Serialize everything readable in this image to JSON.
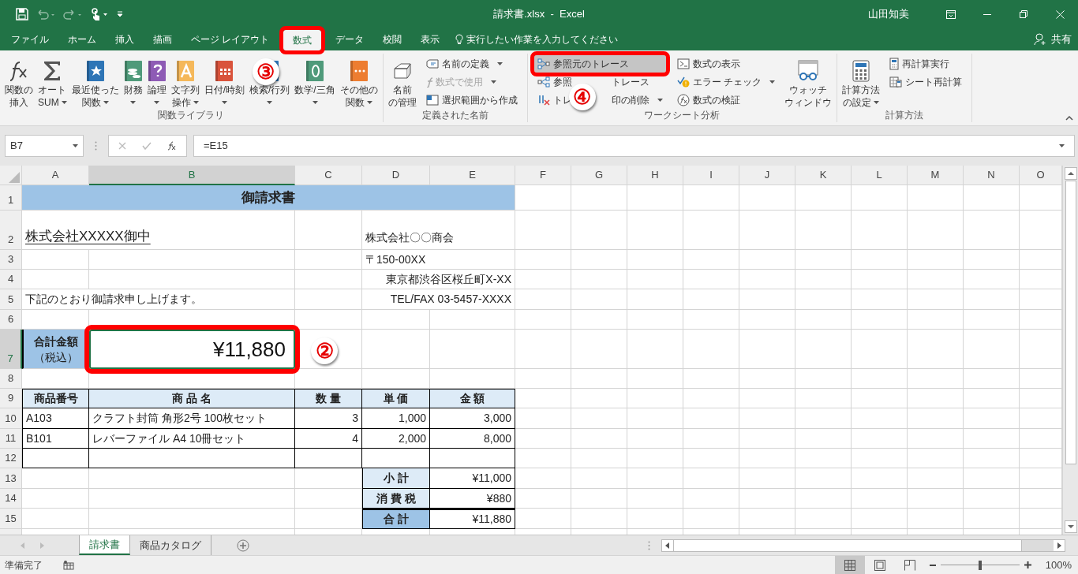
{
  "title_bar": {
    "title": "請求書.xlsx  -  Excel",
    "user": "山田知美"
  },
  "menu_tabs": [
    {
      "label": "ファイル",
      "selected": false,
      "marked": false
    },
    {
      "label": "ホーム",
      "selected": false,
      "marked": false
    },
    {
      "label": "挿入",
      "selected": false,
      "marked": false
    },
    {
      "label": "描画",
      "selected": false,
      "marked": false
    },
    {
      "label": "ページ レイアウト",
      "selected": false,
      "marked": false
    },
    {
      "label": "数式",
      "selected": true,
      "marked": true
    },
    {
      "label": "データ",
      "selected": false,
      "marked": false
    },
    {
      "label": "校閲",
      "selected": false,
      "marked": false
    },
    {
      "label": "表示",
      "selected": false,
      "marked": false
    }
  ],
  "tell_me": {
    "placeholder": "実行したい作業を入力してください"
  },
  "share": "共有",
  "ribbon_groups": [
    {
      "label": "関数ライブラリ",
      "sections": [
        {
          "kind": "large",
          "buttons": [
            {
              "lines": [
                "関数の",
                "挿入"
              ],
              "dropdown": false
            },
            {
              "lines": [
                "オート",
                "SUM"
              ],
              "dropdown": true
            },
            {
              "lines": [
                "最近使った",
                "関数"
              ],
              "dropdown": true
            },
            {
              "lines": [
                "財務"
              ],
              "dropdown": true
            },
            {
              "lines": [
                "論理"
              ],
              "dropdown": true
            },
            {
              "lines": [
                "文字列",
                "操作"
              ],
              "dropdown": true
            },
            {
              "lines": [
                "日付/時刻"
              ],
              "dropdown": true
            },
            {
              "lines": [
                "検索/行列"
              ],
              "dropdown": true,
              "callout": "③"
            },
            {
              "lines": [
                "数学/三角"
              ],
              "dropdown": true
            },
            {
              "lines": [
                "その他の",
                "関数"
              ],
              "dropdown": true
            }
          ]
        }
      ]
    },
    {
      "label": "定義された名前",
      "sections": [
        {
          "kind": "large",
          "buttons": [
            {
              "lines": [
                "名前",
                "の管理"
              ],
              "dropdown": false
            }
          ]
        },
        {
          "kind": "small",
          "buttons": [
            {
              "parts": [
                "名前の定義"
              ],
              "dropdown": true,
              "disabled": false,
              "highlighted": false,
              "marked": false
            },
            {
              "parts": [
                "数式で使用"
              ],
              "dropdown": true,
              "disabled": true,
              "highlighted": false,
              "marked": false
            },
            {
              "parts": [
                "選択範囲から作成"
              ],
              "dropdown": false,
              "disabled": false,
              "highlighted": false,
              "marked": false
            }
          ]
        }
      ]
    },
    {
      "label": "ワークシート分析",
      "sections": [
        {
          "kind": "small",
          "callout": "④",
          "buttons": [
            {
              "parts": [
                "参照元のトレース"
              ],
              "dropdown": false,
              "disabled": false,
              "highlighted": true,
              "marked": true
            },
            {
              "parts": [
                "参照",
                "トレース"
              ],
              "dropdown": false,
              "disabled": false,
              "highlighted": false,
              "marked": false
            },
            {
              "parts": [
                "トレ",
                "印の削除"
              ],
              "dropdown": true,
              "disabled": false,
              "highlighted": false,
              "marked": false
            }
          ]
        },
        {
          "kind": "small",
          "buttons": [
            {
              "parts": [
                "数式の表示"
              ],
              "dropdown": false,
              "disabled": false,
              "highlighted": false,
              "marked": false
            },
            {
              "parts": [
                "エラー チェック"
              ],
              "dropdown": true,
              "disabled": false,
              "highlighted": false,
              "marked": false
            },
            {
              "parts": [
                "数式の検証"
              ],
              "dropdown": false,
              "disabled": false,
              "highlighted": false,
              "marked": false
            }
          ]
        },
        {
          "kind": "large",
          "buttons": [
            {
              "lines": [
                "ウォッチ",
                "ウィンドウ"
              ],
              "dropdown": false
            }
          ]
        }
      ]
    },
    {
      "label": "計算方法",
      "sections": [
        {
          "kind": "large",
          "buttons": [
            {
              "lines": [
                "計算方法",
                "の設定"
              ],
              "dropdown": true
            }
          ]
        },
        {
          "kind": "small",
          "buttons": [
            {
              "parts": [
                "再計算実行"
              ],
              "dropdown": false,
              "disabled": false,
              "highlighted": false,
              "marked": false
            },
            {
              "parts": [
                "シート再計算"
              ],
              "dropdown": false,
              "disabled": false,
              "highlighted": false,
              "marked": false
            }
          ]
        }
      ]
    }
  ],
  "formula_bar": {
    "name_box": "B7",
    "formula": "=E15"
  },
  "columns": [
    {
      "label": "A",
      "selected": false
    },
    {
      "label": "B",
      "selected": true
    },
    {
      "label": "C",
      "selected": false
    },
    {
      "label": "D",
      "selected": false
    },
    {
      "label": "E",
      "selected": false
    },
    {
      "label": "F",
      "selected": false
    },
    {
      "label": "G",
      "selected": false
    },
    {
      "label": "H",
      "selected": false
    },
    {
      "label": "I",
      "selected": false
    },
    {
      "label": "J",
      "selected": false
    },
    {
      "label": "K",
      "selected": false
    },
    {
      "label": "L",
      "selected": false
    },
    {
      "label": "M",
      "selected": false
    },
    {
      "label": "N",
      "selected": false
    },
    {
      "label": "O",
      "selected": false
    }
  ],
  "rows": [
    {
      "label": "1",
      "selected": false
    },
    {
      "label": "2",
      "selected": false
    },
    {
      "label": "3",
      "selected": false
    },
    {
      "label": "4",
      "selected": false
    },
    {
      "label": "5",
      "selected": false
    },
    {
      "label": "6",
      "selected": false
    },
    {
      "label": "7",
      "selected": true
    },
    {
      "label": "8",
      "selected": false
    },
    {
      "label": "9",
      "selected": false
    },
    {
      "label": "10",
      "selected": false
    },
    {
      "label": "11",
      "selected": false
    },
    {
      "label": "12",
      "selected": false
    },
    {
      "label": "13",
      "selected": false
    },
    {
      "label": "14",
      "selected": false
    },
    {
      "label": "15",
      "selected": false
    }
  ],
  "invoice": {
    "title": "御請求書",
    "addressee": "株式会社XXXXX御中",
    "sender_lines": [
      "株式会社〇〇商会",
      "〒150-00XX",
      "東京都渋谷区桜丘町X-XX",
      "TEL/FAX 03-5457-XXXX"
    ],
    "message": "下記のとおり御請求申し上げます。",
    "total_label": [
      "合計金額",
      "（税込）"
    ],
    "total_value": {
      "text": "¥11,880",
      "marked": true,
      "callout": "②"
    },
    "items_header": [
      "商品番号",
      "商 品 名",
      "数 量",
      "単 価",
      "金 額"
    ],
    "items": [
      [
        "A103",
        "クラフト封筒 角形2号 100枚セット",
        "3",
        "1,000",
        "3,000"
      ],
      [
        "B101",
        "レバーファイル A4 10冊セット",
        "4",
        "2,000",
        "8,000"
      ]
    ],
    "summary": [
      {
        "label": "小 計",
        "value": "¥11,000",
        "highlighted": false
      },
      {
        "label": "消 費 税",
        "value": "¥880",
        "highlighted": false
      },
      {
        "label": "合 計",
        "value": "¥11,880",
        "highlighted": true
      }
    ]
  },
  "sheet_tabs": [
    {
      "label": "請求書",
      "selected": true
    },
    {
      "label": "商品カタログ",
      "selected": false
    }
  ],
  "status_bar": {
    "status": "準備完了",
    "zoom": "100%",
    "zoom_slider": {
      "level": 0.5
    }
  }
}
